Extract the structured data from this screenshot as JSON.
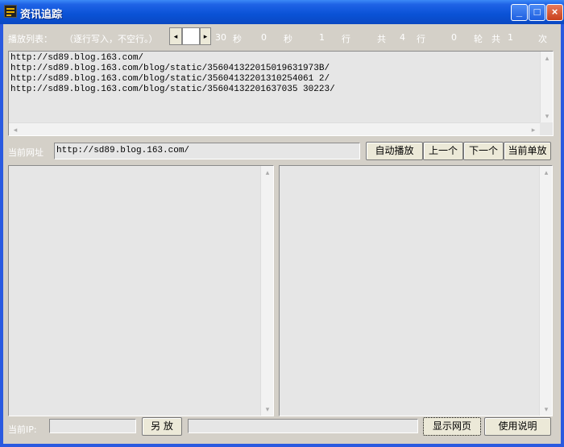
{
  "window": {
    "title": "资讯追踪"
  },
  "title_buttons": {
    "minimize": "_",
    "maximize": "□",
    "close": "×"
  },
  "controls": {
    "playlist_label": "播放列表：",
    "playlist_hint": "（逐行写入，不空行。）",
    "interval_value": "30",
    "unit_sec_1": "秒",
    "elapsed_value": "0",
    "unit_sec_2": "秒",
    "current_line": "1",
    "unit_line_1": "行",
    "total_label": "共",
    "total_lines": "4",
    "unit_line_2": "行",
    "round_value": "0",
    "unit_round": "轮",
    "total_label_2": "共",
    "total_rounds": "1",
    "unit_times": "次"
  },
  "playlist": {
    "lines": [
      "http://sd89.blog.163.com/",
      "http://sd89.blog.163.com/blog/static/356041322015019631973B/",
      "http://sd89.blog.163.com/blog/static/35604132201310254061 2/",
      "http://sd89.blog.163.com/blog/static/35604132201637035 30223/"
    ]
  },
  "url_bar": {
    "label": "当前网址",
    "value": "http://sd89.blog.163.com/"
  },
  "nav_buttons": {
    "auto_play": "自动播放",
    "prev": "上一个",
    "next": "下一个",
    "single": "当前单放"
  },
  "bottom": {
    "ip_label": "当前IP:",
    "ip_value": "",
    "save_as": "另 放",
    "status_value": "",
    "show_page": "显示网页",
    "help": "使用说明"
  },
  "icons": {
    "left_arrow": "◂",
    "right_arrow": "▸",
    "up_arrow": "▴",
    "down_arrow": "▾"
  }
}
